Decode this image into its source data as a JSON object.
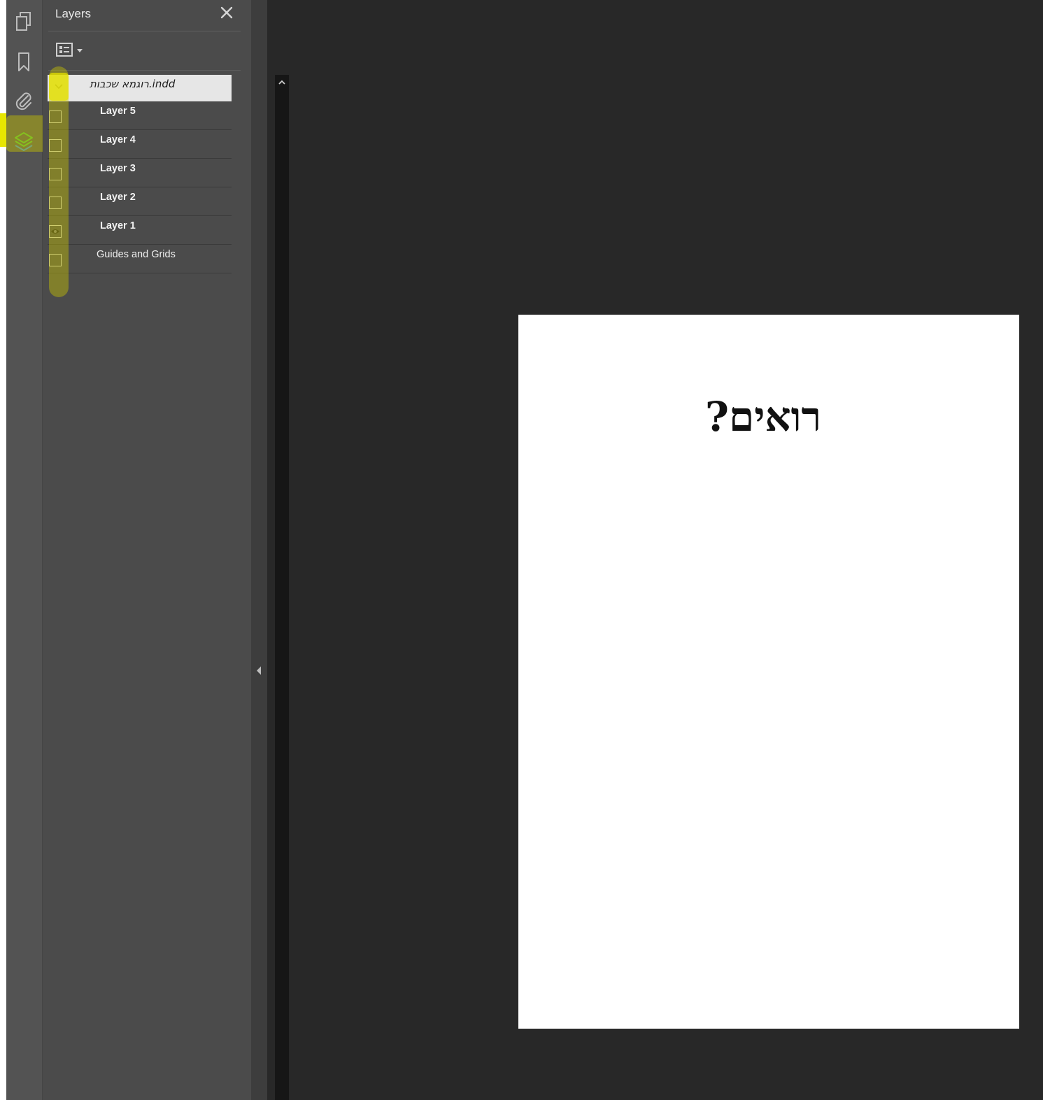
{
  "rail": {
    "icons": [
      "pages-icon",
      "bookmark-icon",
      "attachment-icon",
      "layers-icon"
    ],
    "active": "layers-icon"
  },
  "panel": {
    "title": "Layers",
    "document": {
      "name": "רוגמא שכבות.indd",
      "expanded": true
    },
    "layers": [
      {
        "name": "Layer 5",
        "visible": false,
        "bold": true
      },
      {
        "name": "Layer 4",
        "visible": false,
        "bold": true
      },
      {
        "name": "Layer 3",
        "visible": false,
        "bold": true
      },
      {
        "name": "Layer 2",
        "visible": false,
        "bold": true
      },
      {
        "name": "Layer 1",
        "visible": true,
        "bold": true
      },
      {
        "name": "Guides and Grids",
        "visible": false,
        "bold": false
      }
    ]
  },
  "document_page": {
    "text": "רואים?"
  },
  "colors": {
    "highlight": "#e7e600",
    "panel_bg": "#4b4b4b",
    "canvas_bg": "#282828",
    "layers_icon_green": "#4fbf3a",
    "layers_icon_blue": "#3a8fd8"
  }
}
